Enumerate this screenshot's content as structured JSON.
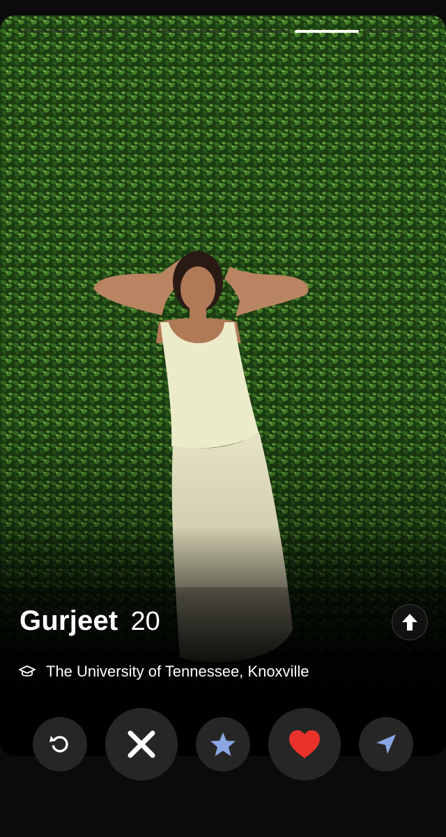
{
  "photo_progress": {
    "total": 6,
    "active_index": 4
  },
  "profile": {
    "name": "Gurjeet",
    "age": "20",
    "school": "The University of Tennessee, Knoxville",
    "school_icon": "graduation-cap-icon"
  },
  "actions": {
    "rewind_icon": "rewind-icon",
    "nope_icon": "close-icon",
    "superlike_icon": "star-icon",
    "like_icon": "heart-icon",
    "boost_icon": "send-icon"
  },
  "colors": {
    "background": "#0b0b0c",
    "button_bg": "#262626",
    "star": "#8aa7e4",
    "heart": "#e8322a",
    "send": "#8aa7e4",
    "hedge": "#2c5a1c"
  }
}
